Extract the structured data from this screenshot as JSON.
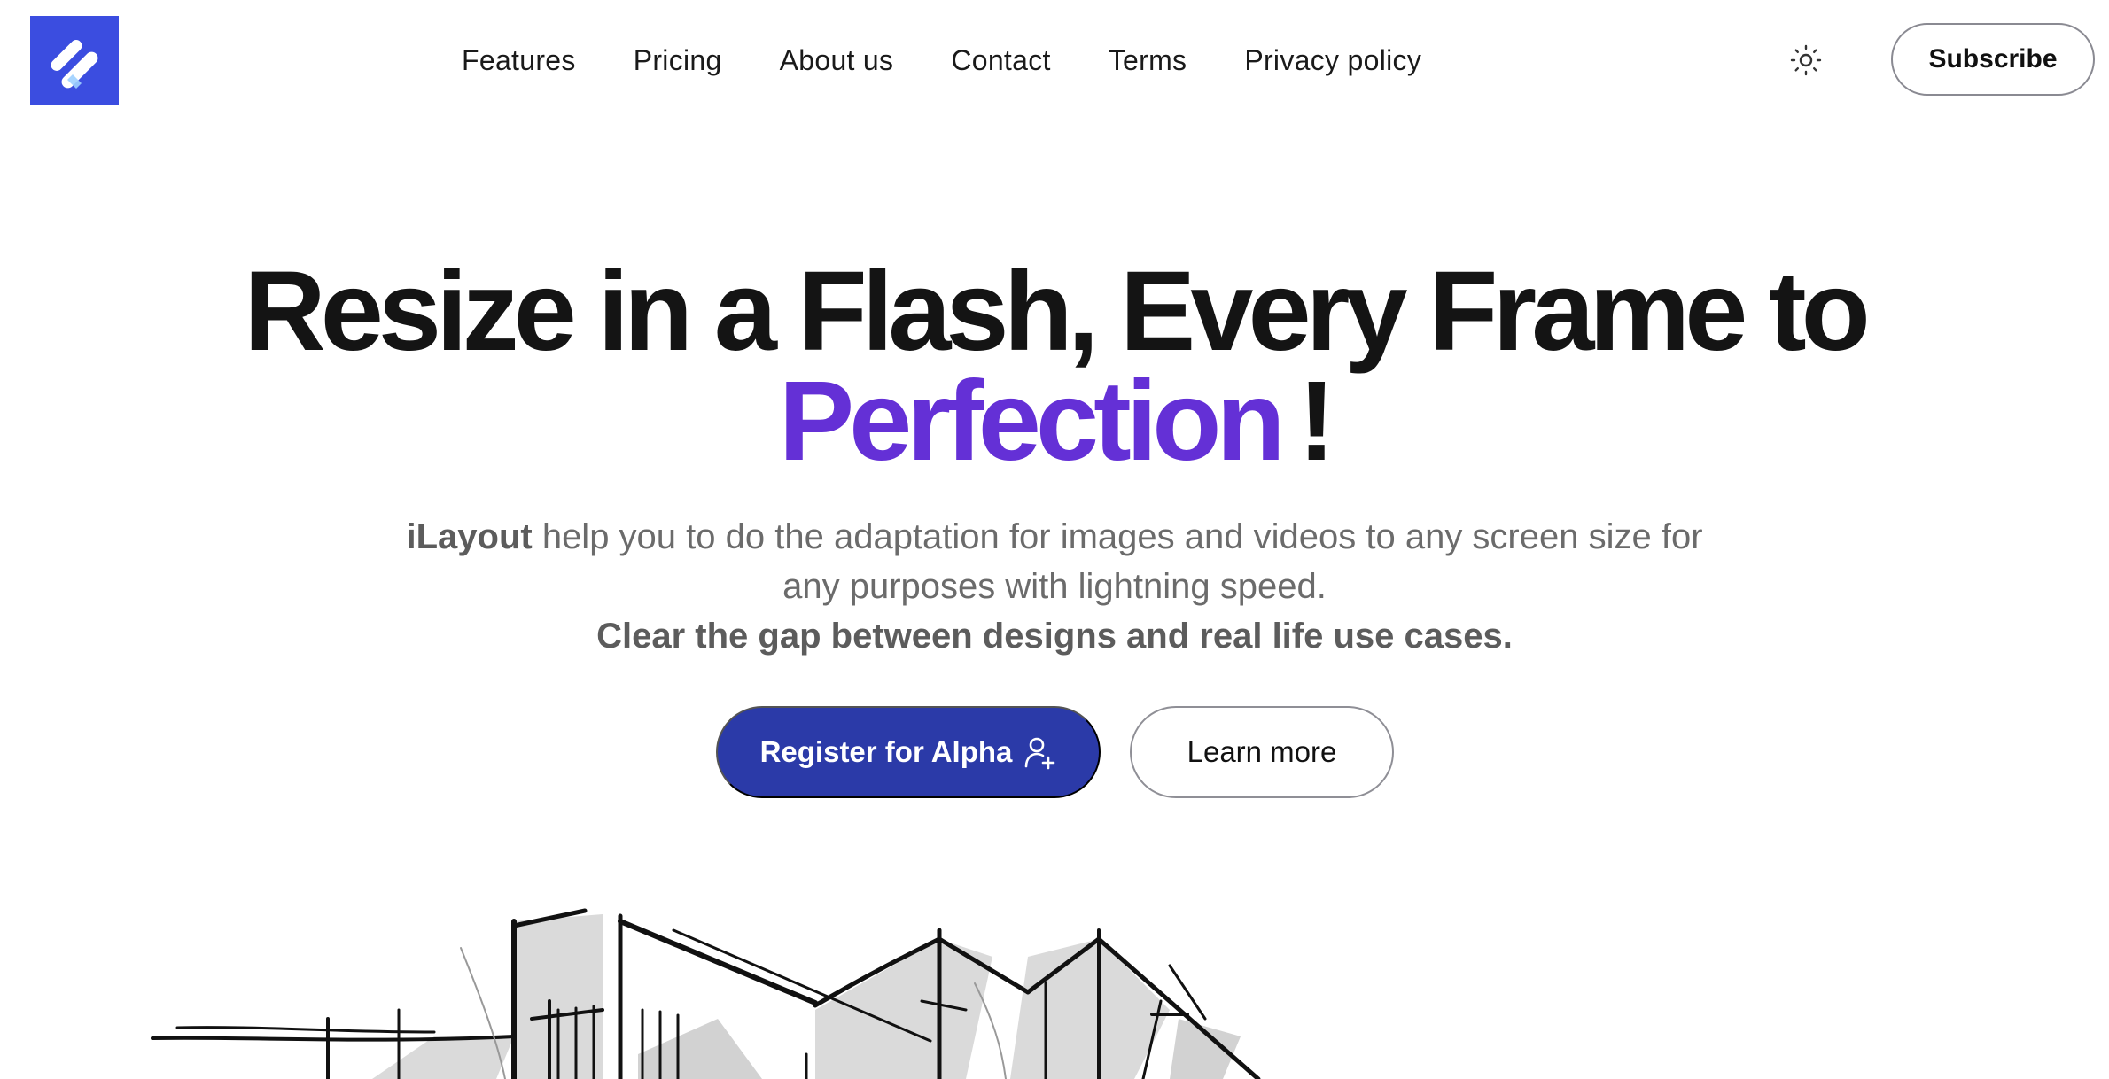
{
  "header": {
    "logo_icon": "ilayout-logo-icon",
    "nav": [
      {
        "label": "Features"
      },
      {
        "label": "Pricing"
      },
      {
        "label": "About us"
      },
      {
        "label": "Contact"
      },
      {
        "label": "Terms"
      },
      {
        "label": "Privacy policy"
      }
    ],
    "theme_toggle_icon": "sun-icon",
    "subscribe_label": "Subscribe"
  },
  "hero": {
    "headline_line1": "Resize in a Flash, Every Frame to",
    "headline_accent": "Perfection",
    "headline_end": "!",
    "brand": "iLayout",
    "description": " help you to do the adaptation for images and videos to any screen size for any purposes with lightning speed.",
    "tagline": "Clear the gap between designs and real life use cases.",
    "primary_cta": "Register for Alpha",
    "primary_cta_icon": "user-plus-icon",
    "secondary_cta": "Learn more",
    "illustration": "building-sketch-illustration"
  },
  "colors": {
    "logo_bg": "#3b4de0",
    "accent": "#6430d6",
    "primary_button": "#2b3aa8"
  }
}
